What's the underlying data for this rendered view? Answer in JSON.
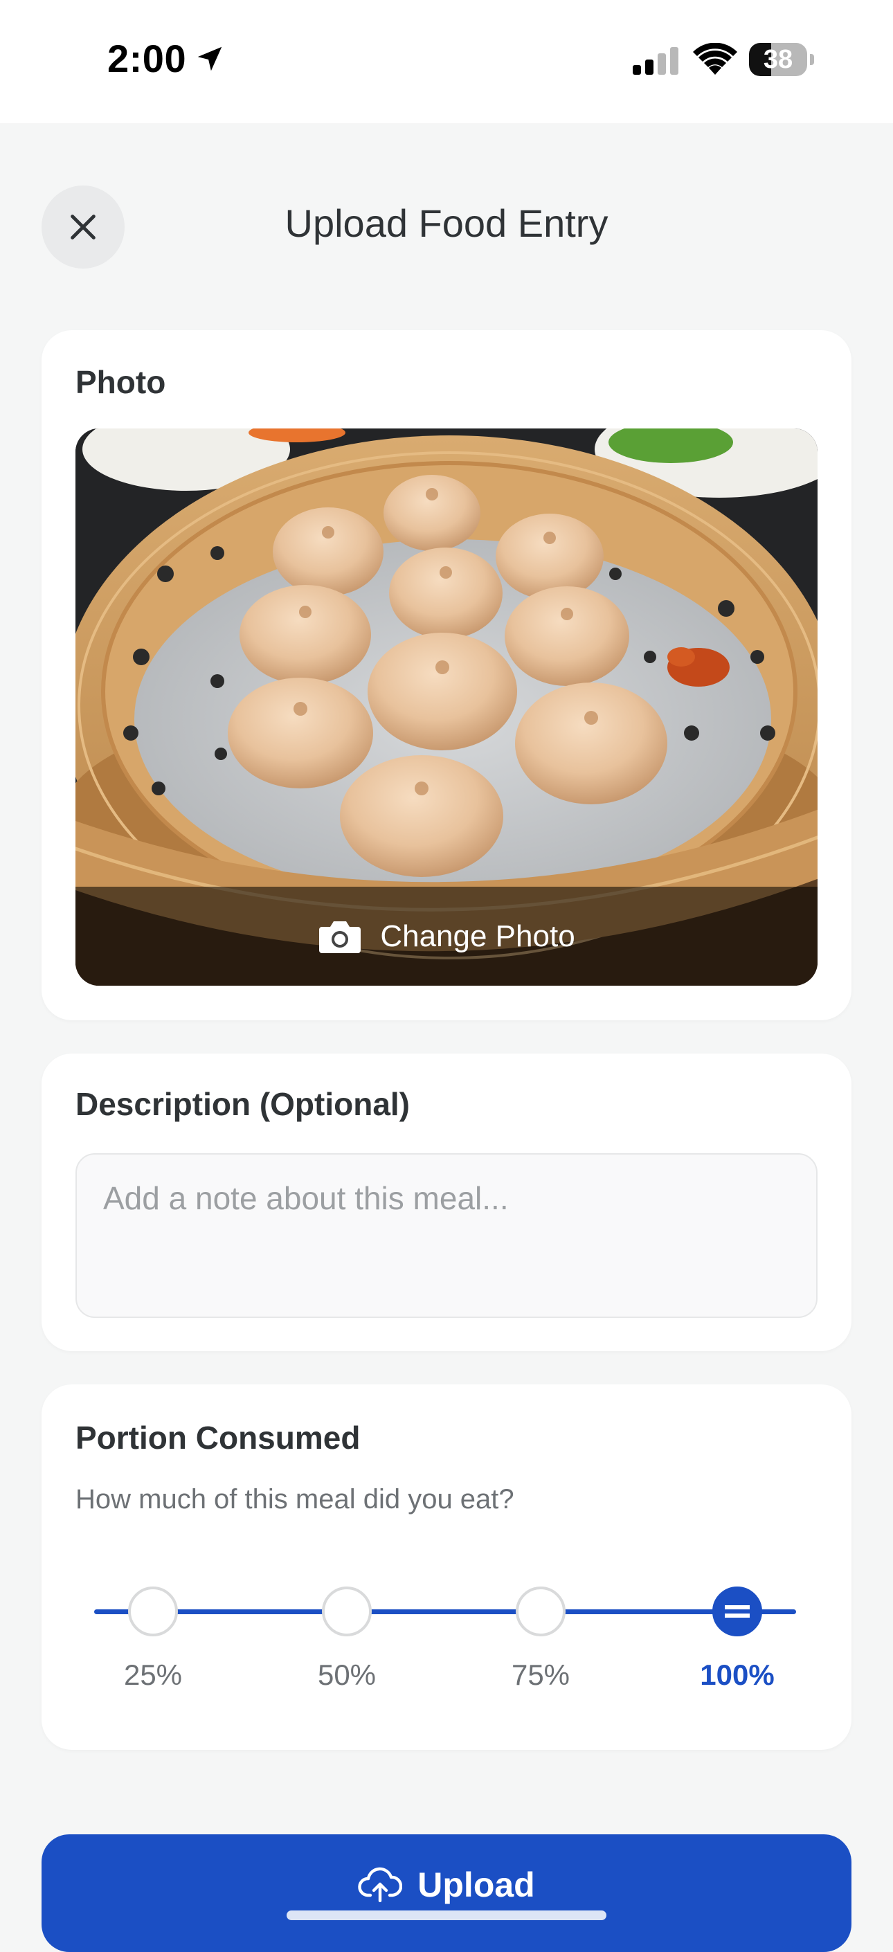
{
  "status_bar": {
    "time": "2:00",
    "battery_level": "38",
    "battery_fraction": 0.38,
    "icons": [
      "location-arrow-icon",
      "cellular-signal-icon",
      "wifi-icon",
      "battery-icon"
    ]
  },
  "header": {
    "title": "Upload Food Entry",
    "close_icon": "close-icon"
  },
  "photo_section": {
    "title": "Photo",
    "image_subject": "soup dumplings in bamboo steamer",
    "change_photo_label": "Change Photo",
    "camera_icon": "camera-icon"
  },
  "description_section": {
    "title": "Description (Optional)",
    "value": "",
    "placeholder": "Add a note about this meal..."
  },
  "portion_section": {
    "title": "Portion Consumed",
    "subtitle": "How much of this meal did you eat?",
    "options": [
      "25%",
      "50%",
      "75%",
      "100%"
    ],
    "selected": "100%"
  },
  "upload_button": {
    "label": "Upload",
    "icon": "cloud-upload-icon"
  },
  "colors": {
    "accent": "#1b4fc4",
    "background": "#f5f6f6",
    "card": "#ffffff",
    "text_primary": "#2f3336",
    "text_secondary": "#6d7175",
    "placeholder": "#9c9fa2"
  }
}
